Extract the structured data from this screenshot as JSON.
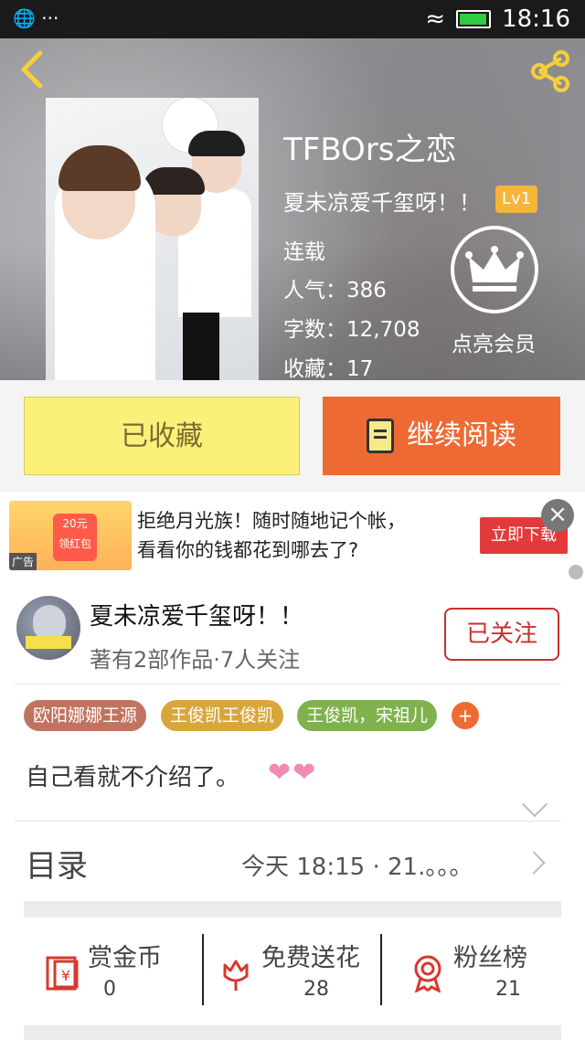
{
  "status_bar": {
    "time": "18:16",
    "notif_dots": "···"
  },
  "header": {
    "back_icon": "back-chevron-icon",
    "share_icon": "share-icon"
  },
  "book": {
    "title": "TFBOrs之恋",
    "author": "夏未凉爱千玺呀！！",
    "level": "Lv1",
    "status": "连载",
    "popularity": "人气：386",
    "word_count": "字数：12,708",
    "favorites": "收藏：17",
    "vip_label": "点亮会员"
  },
  "actions": {
    "collected_label": "已收藏",
    "read_label": "继续阅读"
  },
  "ad": {
    "line1": "拒绝月光族！随时随地记个帐，",
    "line2": "看看你的钱都花到哪去了?",
    "cta": "立即下载",
    "tag": "广告",
    "img_amount": "20元",
    "img_label": "领红包"
  },
  "author_card": {
    "name": "夏未凉爱千玺呀！！",
    "stats": "著有2部作品·7人关注",
    "follow_label": "已关注"
  },
  "tags": [
    {
      "label": "欧阳娜娜王源",
      "color": "#c0735f"
    },
    {
      "label": "王俊凯王俊凯",
      "color": "#d9a63c"
    },
    {
      "label": "王俊凯，宋祖儿",
      "color": "#7fb24e"
    }
  ],
  "tag_more": "+",
  "intro": {
    "text": "自己看就不介绍了。",
    "hearts": "❤❤"
  },
  "toc": {
    "label": "目录",
    "update": "今天 18:15 · 21.。。。"
  },
  "stats": [
    {
      "label": "赏金币",
      "value": "0",
      "icon": "reward-coin-icon"
    },
    {
      "label": "免费送花",
      "value": "28",
      "icon": "flower-icon"
    },
    {
      "label": "粉丝榜",
      "value": "21",
      "icon": "medal-icon"
    }
  ]
}
